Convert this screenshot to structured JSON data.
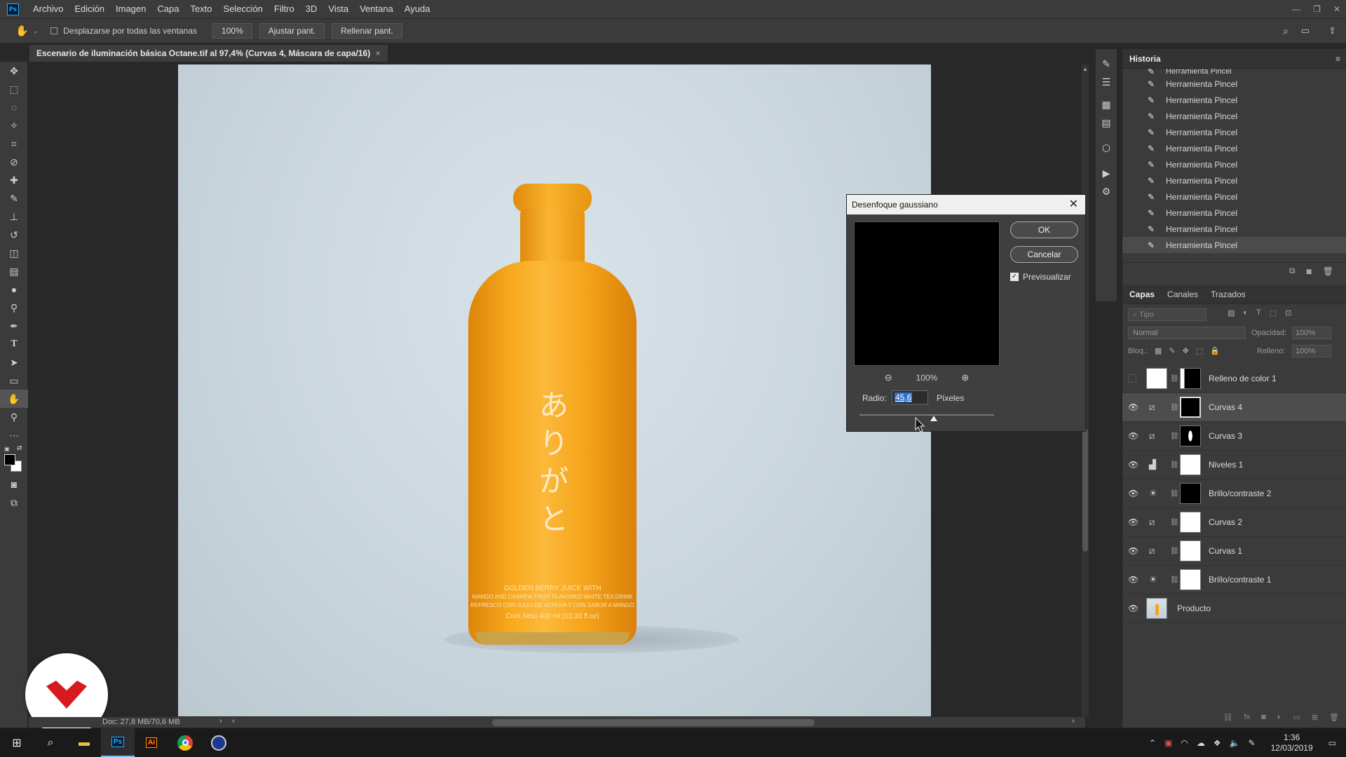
{
  "menu": {
    "logo": "Ps",
    "items": [
      "Archivo",
      "Edición",
      "Imagen",
      "Capa",
      "Texto",
      "Selección",
      "Filtro",
      "3D",
      "Vista",
      "Ventana",
      "Ayuda"
    ]
  },
  "options": {
    "scroll_all_label": "Desplazarse por todas las ventanas",
    "zoom": "100%",
    "fit_label": "Ajustar pant.",
    "fill_label": "Rellenar pant."
  },
  "doc_tab": "Escenario de iluminación básica Octane.tif al 97,4% (Curvas 4, Máscara de capa/16)",
  "status": "Doc: 27,8 MB/70,6 MB",
  "bottle": {
    "japanese": [
      "あ",
      "り",
      "が",
      "と"
    ],
    "label_lines": [
      "GOLDEN BERRY JUICE WITH",
      "MANGO AND CASHEW FRUIT FLAVORED WHITE TEA DRINK",
      "REFRESCO CON JUGO DE UCHUVA Y CON SABOR A MANGO",
      "Cont.Neto 400 ml (13,33 fl.oz)"
    ]
  },
  "dialog": {
    "title": "Desenfoque gaussiano",
    "ok": "OK",
    "cancel": "Cancelar",
    "preview_label": "Previsualizar",
    "preview_checked": true,
    "zoom": "100%",
    "radius_label": "Radio:",
    "radius_value": "45,6",
    "radius_unit": "Píxeles",
    "slider_fraction": 0.55
  },
  "history": {
    "title": "Historia",
    "items": [
      "Herramienta Pincel",
      "Herramienta Pincel",
      "Herramienta Pincel",
      "Herramienta Pincel",
      "Herramienta Pincel",
      "Herramienta Pincel",
      "Herramienta Pincel",
      "Herramienta Pincel",
      "Herramienta Pincel",
      "Herramienta Pincel",
      "Herramienta Pincel",
      "Herramienta Pincel"
    ]
  },
  "layers_panel": {
    "tabs": [
      "Capas",
      "Canales",
      "Trazados"
    ],
    "filter_placeholder": "Tipo",
    "blend": "Normal",
    "opacity_label": "Opacidad:",
    "opacity": "100%",
    "lock_label": "Bloq.:",
    "fill_label": "Relleno:",
    "fill": "100%",
    "layers": [
      {
        "name": "Relleno de color 1",
        "icon": "",
        "visible": false
      },
      {
        "name": "Curvas 4",
        "icon": "curves-icon",
        "visible": true
      },
      {
        "name": "Curvas 3",
        "icon": "curves-icon",
        "visible": true
      },
      {
        "name": "Niveles 1",
        "icon": "levels-icon",
        "visible": true
      },
      {
        "name": "Brillo/contraste 2",
        "icon": "brightness-icon",
        "visible": true
      },
      {
        "name": "Curvas 2",
        "icon": "curves-icon",
        "visible": true
      },
      {
        "name": "Curvas 1",
        "icon": "curves-icon",
        "visible": true
      },
      {
        "name": "Brillo/contraste 1",
        "icon": "brightness-icon",
        "visible": true
      },
      {
        "name": "Producto",
        "icon": "",
        "visible": true
      }
    ]
  },
  "taskbar": {
    "time": "1:36",
    "date": "12/03/2019"
  },
  "colors": {
    "bottle": "#f5a31a",
    "accent": "#31a8ff",
    "logo_red": "#d71920"
  }
}
